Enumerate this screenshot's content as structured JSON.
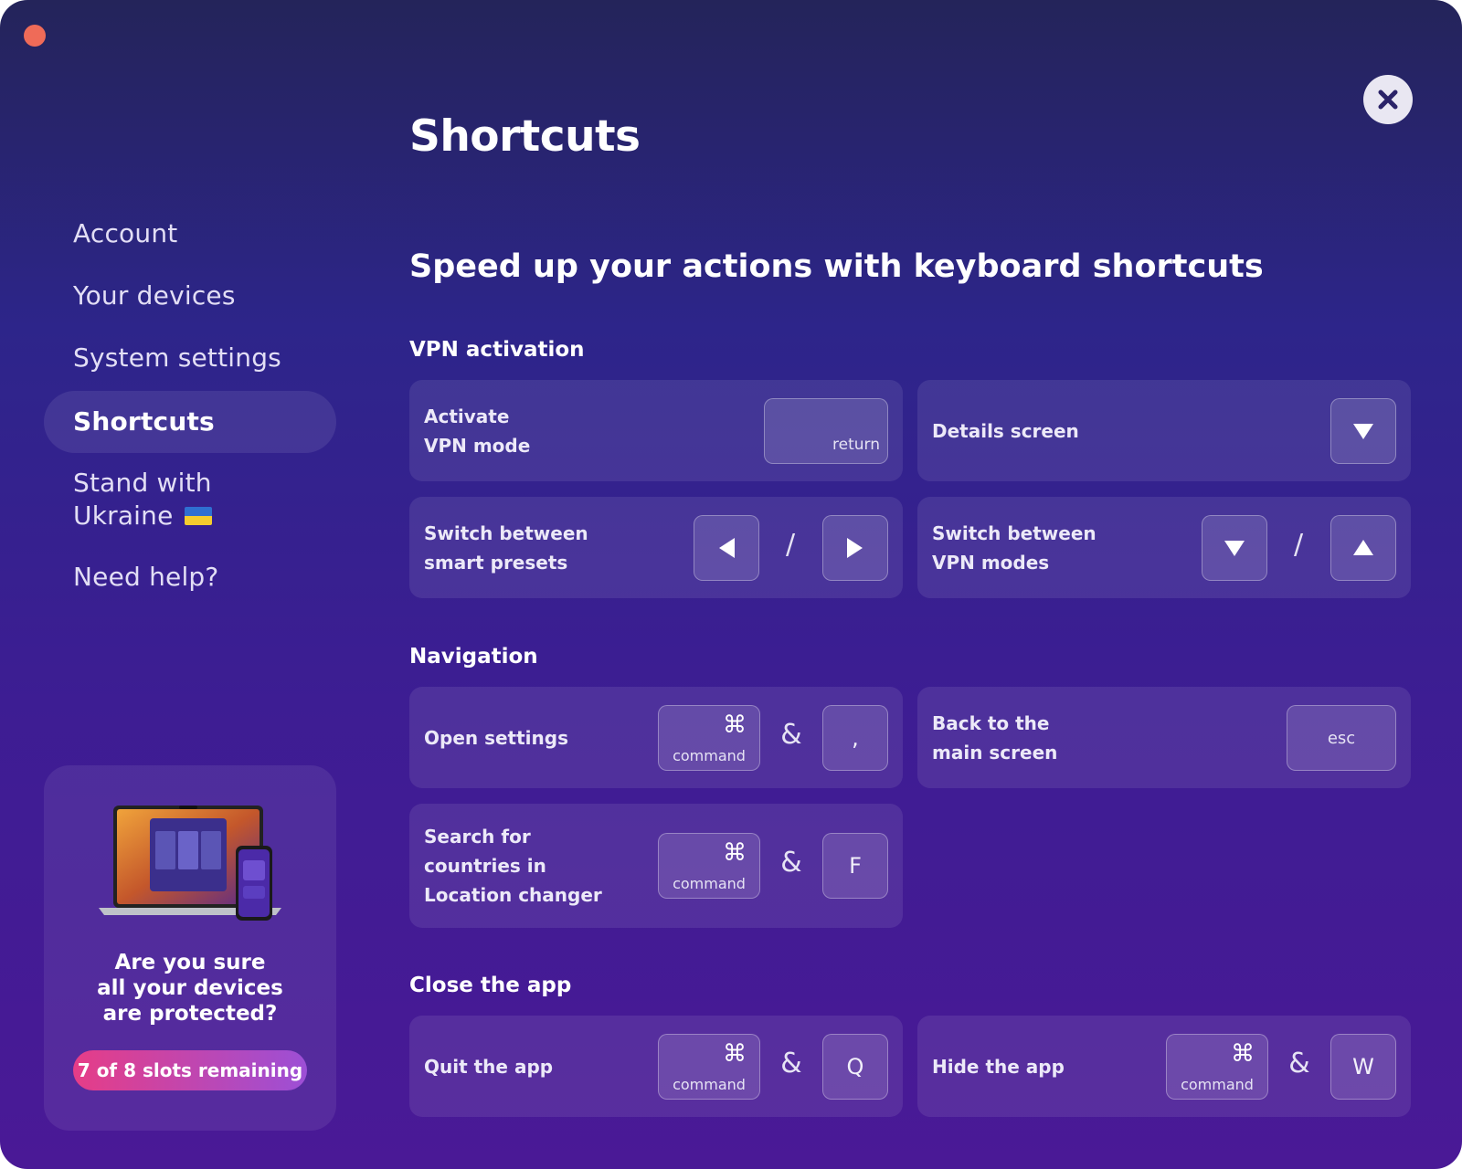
{
  "window": {
    "title": "Shortcuts"
  },
  "sidebar": {
    "items": [
      {
        "label": "Account"
      },
      {
        "label": "Your devices"
      },
      {
        "label": "System settings"
      },
      {
        "label": "Shortcuts"
      },
      {
        "label_line1": "Stand with",
        "label_line2": "Ukraine"
      },
      {
        "label": "Need help?"
      }
    ],
    "active_item": "Shortcuts"
  },
  "promo": {
    "text_lines": [
      "Are you sure",
      "all your devices",
      "are protected?"
    ],
    "badge": "7 of 8 slots remaining"
  },
  "main": {
    "subtitle": "Speed up your actions with keyboard shortcuts",
    "sections": {
      "vpn": {
        "title": "VPN activation",
        "activate": {
          "line1": "Activate",
          "line2": "VPN mode",
          "key": "return"
        },
        "details": {
          "label": "Details screen"
        },
        "presets": {
          "line1": "Switch between",
          "line2": "smart presets",
          "sep": "/"
        },
        "modes": {
          "line1": "Switch between",
          "line2": "VPN modes",
          "sep": "/"
        }
      },
      "navigation": {
        "title": "Navigation",
        "open_settings": {
          "label": "Open settings",
          "cmd_glyph": "⌘",
          "cmd_label": "command",
          "sep": "&",
          "key": ","
        },
        "back": {
          "line1": "Back to the",
          "line2": "main screen",
          "key": "esc"
        },
        "search": {
          "line1": "Search for",
          "line2": "countries in",
          "line3": "Location changer",
          "cmd_glyph": "⌘",
          "cmd_label": "command",
          "sep": "&",
          "key": "F"
        }
      },
      "close": {
        "title": "Close the app",
        "quit": {
          "label": "Quit the app",
          "cmd_glyph": "⌘",
          "cmd_label": "command",
          "sep": "&",
          "key": "Q"
        },
        "hide": {
          "label": "Hide the app",
          "cmd_glyph": "⌘",
          "cmd_label": "command",
          "sep": "&",
          "key": "W"
        }
      }
    }
  },
  "colors": {
    "background_top": "#24245a",
    "background_bottom": "#4a1996",
    "traffic_close": "#ef6b58",
    "badge_start": "#e63d87",
    "badge_end": "#9c4fd6",
    "ukraine_blue": "#2f6fd1",
    "ukraine_yellow": "#f4cc2e"
  }
}
